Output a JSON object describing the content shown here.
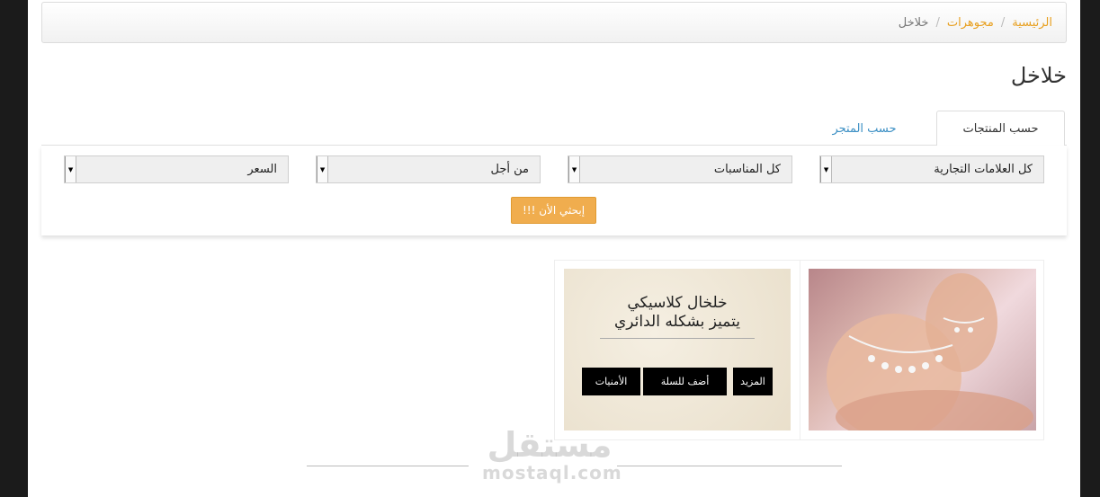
{
  "breadcrumb": {
    "home": "الرئيسية",
    "category": "مجوهرات",
    "current": "خلاخل",
    "separator": "/"
  },
  "page_title": "خلاخل",
  "tabs": {
    "by_products": "حسب المنتجات",
    "by_store": "حسب المتجر"
  },
  "filters": {
    "brands": "كل العلامات التجارية",
    "occasions": "كل المناسبات",
    "for_whom": "من أجل",
    "price": "السعر",
    "search_button": "إبحثي الأن !!!"
  },
  "product": {
    "name_line1": "خلخال كلاسيكي",
    "name_line2": "يتميز بشكله الدائري",
    "more_button": "المزيد",
    "add_to_cart_button": "أضف للسلة",
    "wishlist_button": "الأمنيات"
  },
  "watermark": {
    "arabic": "مستقل",
    "latin": "mostaql.com"
  },
  "colors": {
    "accent": "#f0ad4e",
    "link": "#e8a020",
    "tab_link": "#3b8fc4"
  }
}
